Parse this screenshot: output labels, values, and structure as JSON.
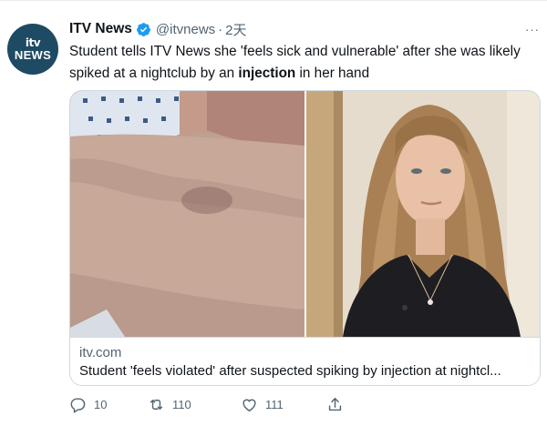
{
  "account": {
    "avatar_top": "itv",
    "avatar_bottom": "NEWS",
    "name": "ITV News",
    "handle": "@itvnews",
    "separator": "·",
    "time": "2天"
  },
  "tweet": {
    "text_before": "Student tells ITV News she 'feels sick and vulnerable' after she was likely spiked at a nightclub by an ",
    "text_bold": "injection",
    "text_after": " in her hand"
  },
  "card": {
    "domain": "itv.com",
    "title": "Student 'feels violated' after suspected spiking by injection at nightcl..."
  },
  "actions": {
    "reply_count": "10",
    "retweet_count": "110",
    "like_count": "111"
  },
  "more_label": "···",
  "colors": {
    "verified": "#1d9bf0",
    "secondary_text": "#536471",
    "avatar_bg": "#1f4a63"
  },
  "icons": [
    "verified-badge-icon",
    "more-icon",
    "reply-icon",
    "retweet-icon",
    "like-icon",
    "share-icon"
  ]
}
